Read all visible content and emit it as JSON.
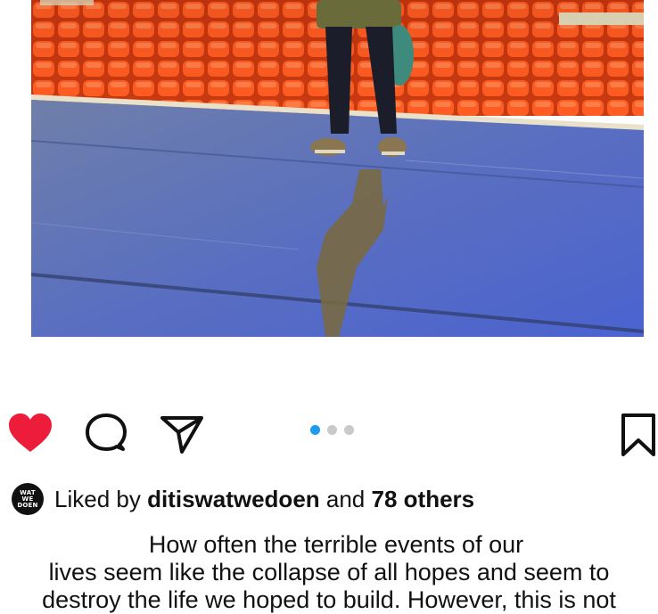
{
  "post": {
    "carousel": {
      "total": 3,
      "active_index": 0
    },
    "liked": true
  },
  "likes": {
    "prefix": "Liked by",
    "user": "ditiswatwedoen",
    "connector": "and",
    "others": "78 others",
    "avatar_text": [
      "WAT",
      "WE",
      "DOEN"
    ]
  },
  "caption": {
    "lines": [
      "How often the terrible events of our",
      "lives seem like the collapse of all hopes and seem to",
      "destroy the life we hoped to build. However, this is not"
    ]
  },
  "icons": {
    "like": "heart-icon",
    "comment": "comment-icon",
    "share": "send-icon",
    "save": "bookmark-icon"
  },
  "colors": {
    "heart": "#ed1c3a",
    "active_dot": "#1d9bf0",
    "inactive_dot": "#c9c9c9",
    "seats": "#ff5a1f",
    "stage": "#5a6fc0"
  }
}
